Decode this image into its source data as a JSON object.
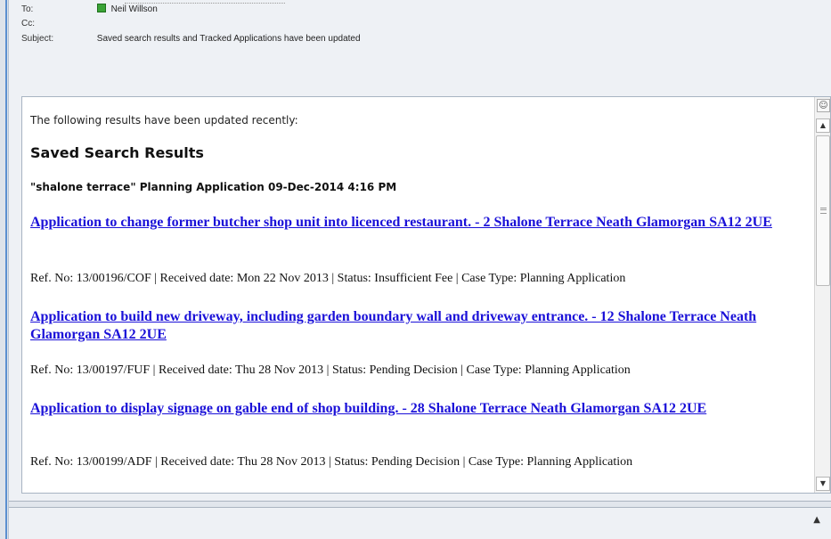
{
  "header": {
    "to_label": "To:",
    "to_value": "Neil Willson",
    "cc_label": "Cc:",
    "subject_label": "Subject:",
    "subject_value": "Saved search results and Tracked Applications have been updated"
  },
  "body": {
    "intro": "The following results have been updated recently:",
    "section_title": "Saved Search Results",
    "search_title": "\"shalone terrace\" Planning Application 09-Dec-2014 4:16 PM",
    "results": [
      {
        "link": "Application to change former butcher shop unit into licenced restaurant. - 2 Shalone Terrace Neath Glamorgan SA12 2UE",
        "meta": "Ref. No: 13/00196/COF  | Received date: Mon 22 Nov 2013 | Status: Insufficient Fee | Case Type: Planning Application"
      },
      {
        "link": "Application to build new driveway, including garden boundary wall and driveway entrance. - 12 Shalone Terrace Neath Glamorgan SA12 2UE",
        "meta": "Ref. No: 13/00197/FUF | Received date: Thu 28 Nov 2013 | Status: Pending Decision | Case Type: Planning Application"
      },
      {
        "link": "Application to display signage on gable end of shop building. - 28 Shalone Terrace Neath Glamorgan SA12 2UE",
        "meta": "Ref. No: 13/00199/ADF  | Received date: Thu 28 Nov 2013 | Status: Pending Decision | Case Type: Planning Application"
      }
    ]
  },
  "icons": {
    "contact": "contact-status-icon",
    "people_pane": "people-pane-icon",
    "scroll_up": "chevron-up-icon",
    "scroll_down": "chevron-down-icon",
    "footer_caret": "caret-up-icon"
  },
  "colors": {
    "link": "#1a10d8",
    "contact_online": "#3aa336"
  }
}
